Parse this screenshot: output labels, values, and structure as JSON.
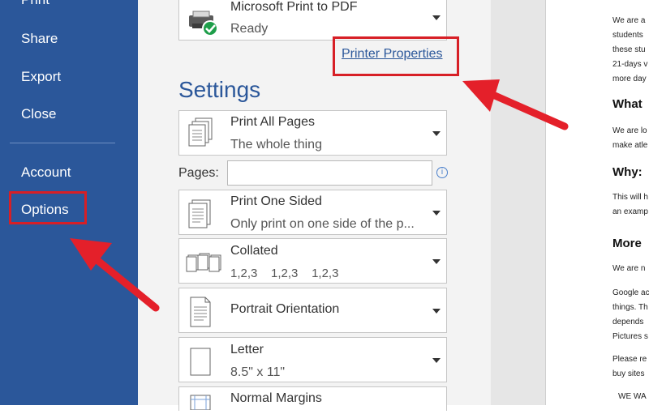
{
  "sidebar": {
    "items": [
      {
        "label": "Print"
      },
      {
        "label": "Share"
      },
      {
        "label": "Export"
      },
      {
        "label": "Close"
      },
      {
        "label": "Account"
      },
      {
        "label": "Options"
      }
    ]
  },
  "printer": {
    "name": "Microsoft Print to PDF",
    "status": "Ready",
    "properties_link": "Printer Properties"
  },
  "settings": {
    "title": "Settings",
    "pages_label": "Pages:",
    "pages_value": "",
    "dropdowns": [
      {
        "label": "Print All Pages",
        "sub": "The whole thing",
        "icon": "pages-icon"
      },
      {
        "label": "Print One Sided",
        "sub": "Only print on one side of the p...",
        "icon": "one-sided-icon"
      },
      {
        "label": "Collated",
        "sub": "1,2,3    1,2,3    1,2,3",
        "icon": "collated-icon"
      },
      {
        "label": "Portrait Orientation",
        "sub": "",
        "icon": "portrait-icon"
      },
      {
        "label": "Letter",
        "sub": "8.5\" x 11\"",
        "icon": "letter-icon"
      },
      {
        "label": "Normal Margins",
        "sub": "",
        "icon": "margins-icon"
      }
    ]
  },
  "preview": {
    "lines": [
      {
        "text": "We are a"
      },
      {
        "text": "students"
      },
      {
        "text": "these stu"
      },
      {
        "text": "21-days v"
      },
      {
        "text": "more day"
      },
      {
        "text": "What",
        "heading": true
      },
      {
        "text": "We are lo"
      },
      {
        "text": "make atle"
      },
      {
        "text": "Why:",
        "heading": true
      },
      {
        "text": "This will h"
      },
      {
        "text": "an examp"
      },
      {
        "text": "More",
        "heading": true
      },
      {
        "text": "We are n"
      },
      {
        "text": "Google ac"
      },
      {
        "text": "things. Th"
      },
      {
        "text": "depends"
      },
      {
        "text": "Pictures s"
      },
      {
        "text": "Please re"
      },
      {
        "text": "buy sites"
      },
      {
        "text": "WE WA"
      }
    ]
  },
  "colors": {
    "sidebar": "#2b579a",
    "accent": "#2b579a",
    "highlight": "#d71f26"
  }
}
